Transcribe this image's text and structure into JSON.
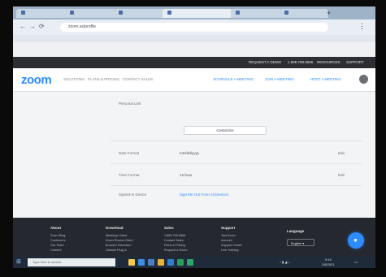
{
  "browser": {
    "url": "zoom.us/profile",
    "new_tab": "+",
    "menu": "⋮",
    "nav": {
      "back": "←",
      "forward": "→",
      "reload": "⟳"
    }
  },
  "zoom": {
    "logo": "zoom",
    "top_links": [
      "REQUEST A DEMO",
      "1.888.799.9666",
      "RESOURCES",
      "SUPPORT"
    ],
    "nav_left": [
      "SOLUTIONS",
      "PLANS & PRICING",
      "CONTACT SALES"
    ],
    "nav_right": [
      "SCHEDULE A MEETING",
      "JOIN A MEETING",
      "HOST A MEETING"
    ]
  },
  "content": {
    "personal_link_label": "Personal Link",
    "button_label": "Customize",
    "date_format_label": "Date Format",
    "date_format_value": "mm/dd/yyyy",
    "edit1": "Edit",
    "time_format_label": "Time Format",
    "time_format_value": "12-hour",
    "edit2": "Edit",
    "sign_in_label": "Signed-In Device",
    "sign_in_link": "Sign Me Out From All Devices"
  },
  "footer": {
    "cols": [
      {
        "head": "About",
        "items": [
          "Zoom Blog",
          "Customers",
          "Our Team",
          "Careers"
        ]
      },
      {
        "head": "Download",
        "items": [
          "Meetings Client",
          "Zoom Rooms Client",
          "Browser Extension",
          "Outlook Plug-in"
        ]
      },
      {
        "head": "Sales",
        "items": [
          "1.888.799.9666",
          "Contact Sales",
          "Plans & Pricing",
          "Request a Demo"
        ]
      },
      {
        "head": "Support",
        "items": [
          "Test Zoom",
          "Account",
          "Support Center",
          "Live Training"
        ]
      }
    ],
    "language_head": "Language",
    "language_value": "English ▾"
  },
  "taskbar": {
    "search_placeholder": "Type here to search",
    "clock_time": "9:15",
    "clock_date": "2/8/2021"
  },
  "fab_icon": "●",
  "colors": {
    "zoom_blue": "#2d8cff",
    "footer_bg": "#25292f",
    "topbar_bg": "#2d2f33"
  }
}
